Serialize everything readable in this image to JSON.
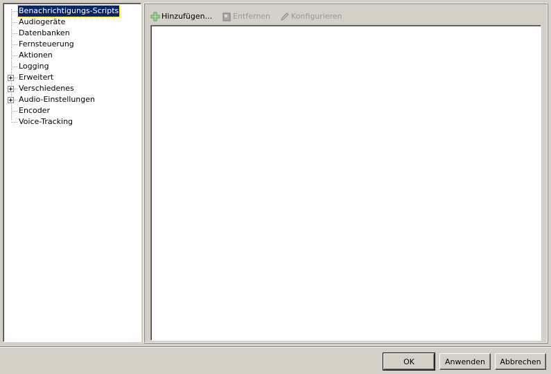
{
  "tree": {
    "items": [
      {
        "label": "Benachrichtigungs-Scripts",
        "selected": true,
        "expandable": false
      },
      {
        "label": "Audiogeräte",
        "selected": false,
        "expandable": false
      },
      {
        "label": "Datenbanken",
        "selected": false,
        "expandable": false
      },
      {
        "label": "Fernsteuerung",
        "selected": false,
        "expandable": false
      },
      {
        "label": "Aktionen",
        "selected": false,
        "expandable": false
      },
      {
        "label": "Logging",
        "selected": false,
        "expandable": false
      },
      {
        "label": "Erweitert",
        "selected": false,
        "expandable": true
      },
      {
        "label": "Verschiedenes",
        "selected": false,
        "expandable": true
      },
      {
        "label": "Audio-Einstellungen",
        "selected": false,
        "expandable": true
      },
      {
        "label": "Encoder",
        "selected": false,
        "expandable": false
      },
      {
        "label": "Voice-Tracking",
        "selected": false,
        "expandable": false
      }
    ]
  },
  "toolbar": {
    "add_label": "Hinzufügen...",
    "remove_label": "Entfernen",
    "configure_label": "Konfigurieren"
  },
  "buttons": {
    "ok_label": "OK",
    "apply_label": "Anwenden",
    "cancel_label": "Abbrechen"
  },
  "icons": {
    "add": "plus-icon",
    "remove": "trash-icon",
    "configure": "pencil-icon"
  }
}
